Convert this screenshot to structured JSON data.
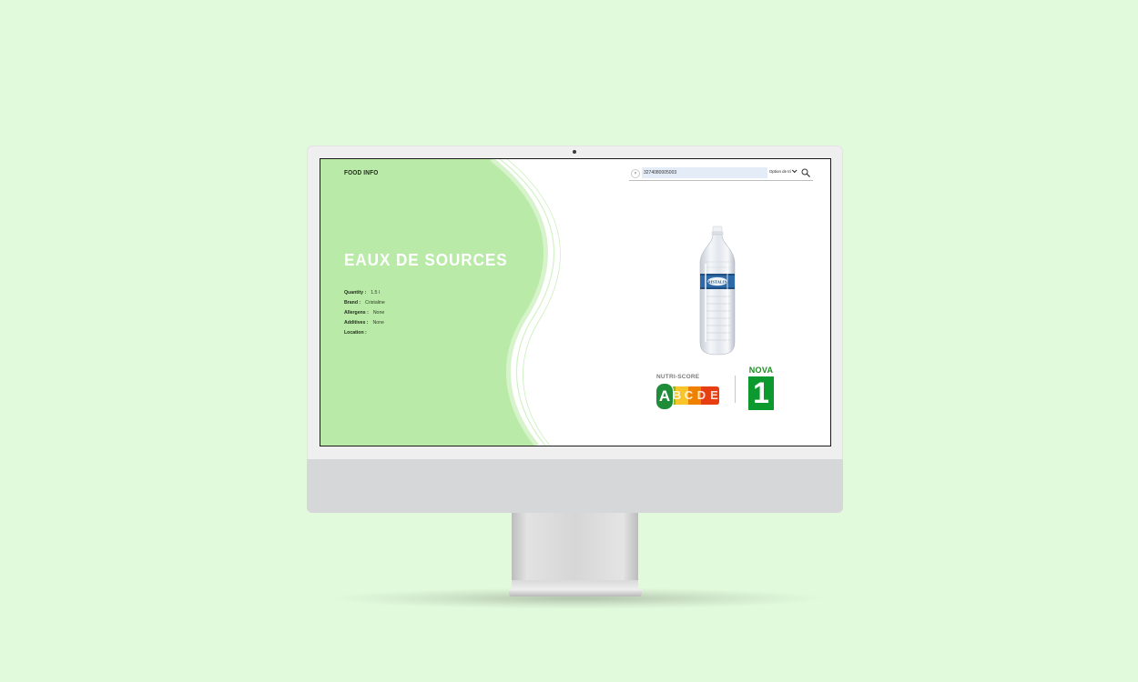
{
  "app": {
    "brand": "FOOD INFO"
  },
  "search": {
    "clear_symbol": "×",
    "query": "3274080005003",
    "sort_label": "Option de tri"
  },
  "product": {
    "title": "EAUX DE SOURCES",
    "fields": [
      {
        "label": "Quantity :",
        "value": "1.5 l"
      },
      {
        "label": "Brand :",
        "value": "Cristaline"
      },
      {
        "label": "Allergens :",
        "value": "None"
      },
      {
        "label": "Additives :",
        "value": "None"
      },
      {
        "label": "Location :",
        "value": ""
      }
    ],
    "bottle_label": "CRISTALINE"
  },
  "scores": {
    "nutriscore_title": "NUTRI-SCORE",
    "nutriscore_letters": [
      "A",
      "B",
      "C",
      "D",
      "E"
    ],
    "nutriscore_selected": "A",
    "nova_label": "NOVA",
    "nova_value": "1"
  },
  "colors": {
    "page_background": "#e2fadc",
    "panel_green": "#b9eaa8",
    "nutri_a": "#1f8c3a",
    "nutri_b": "#86bc25",
    "nutri_c": "#f7c52a",
    "nutri_d": "#ee8100",
    "nutri_e": "#e63e11",
    "nova_green": "#0c9a2e"
  },
  "icons": {
    "search": "search-icon",
    "clear": "close-icon",
    "dropdown": "chevron-down-icon"
  }
}
